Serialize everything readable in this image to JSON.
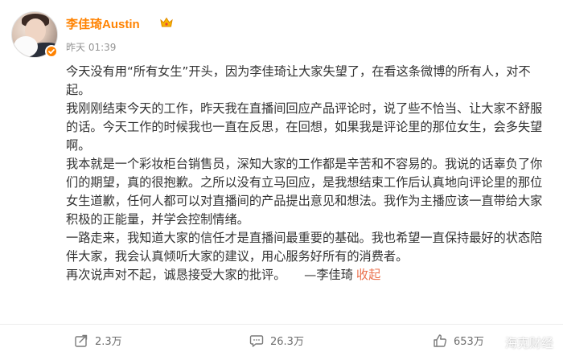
{
  "user": {
    "name": "李佳琦Austin",
    "timestamp": "昨天 01:39"
  },
  "post": {
    "paragraphs": [
      "今天没有用“所有女生”开头，因为李佳琦让大家失望了，在看这条微博的所有人，对不起。",
      "我刚刚结束今天的工作，昨天我在直播间回应产品评论时，说了些不恰当、让大家不舒服的话。今天工作的时候我也一直在反思，在回想，如果我是评论里的那位女生，会多失望啊。",
      "我本就是一个彩妆柜台销售员，深知大家的工作都是辛苦和不容易的。我说的话辜负了你们的期望，真的很抱歉。之所以没有立马回应，是我想结束工作后认真地向评论里的那位女生道歉，任何人都可以对直播间的产品提出意见和想法。我作为主播应该一直带给大家积极的正能量，并学会控制情绪。",
      "一路走来，我知道大家的信任才是直播间最重要的基础。我也希望一直保持最好的状态陪伴大家，我会认真倾听大家的建议，用心服务好所有的消费者。"
    ],
    "last_line": "再次说声对不起，诚恳接受大家的批评。　　—李佳琦",
    "collapse_label": "收起"
  },
  "actions": {
    "share_count": "2.3万",
    "comment_count": "26.3万",
    "like_count": "653万"
  },
  "watermark": {
    "text": "海克财经"
  },
  "colors": {
    "username": "#ff8200",
    "link": "#eb7350",
    "meta": "#939393"
  },
  "icons": {
    "verified": "verified-badge-icon",
    "member": "crown-icon",
    "share": "share-icon",
    "comment": "comment-icon",
    "like": "like-icon"
  }
}
